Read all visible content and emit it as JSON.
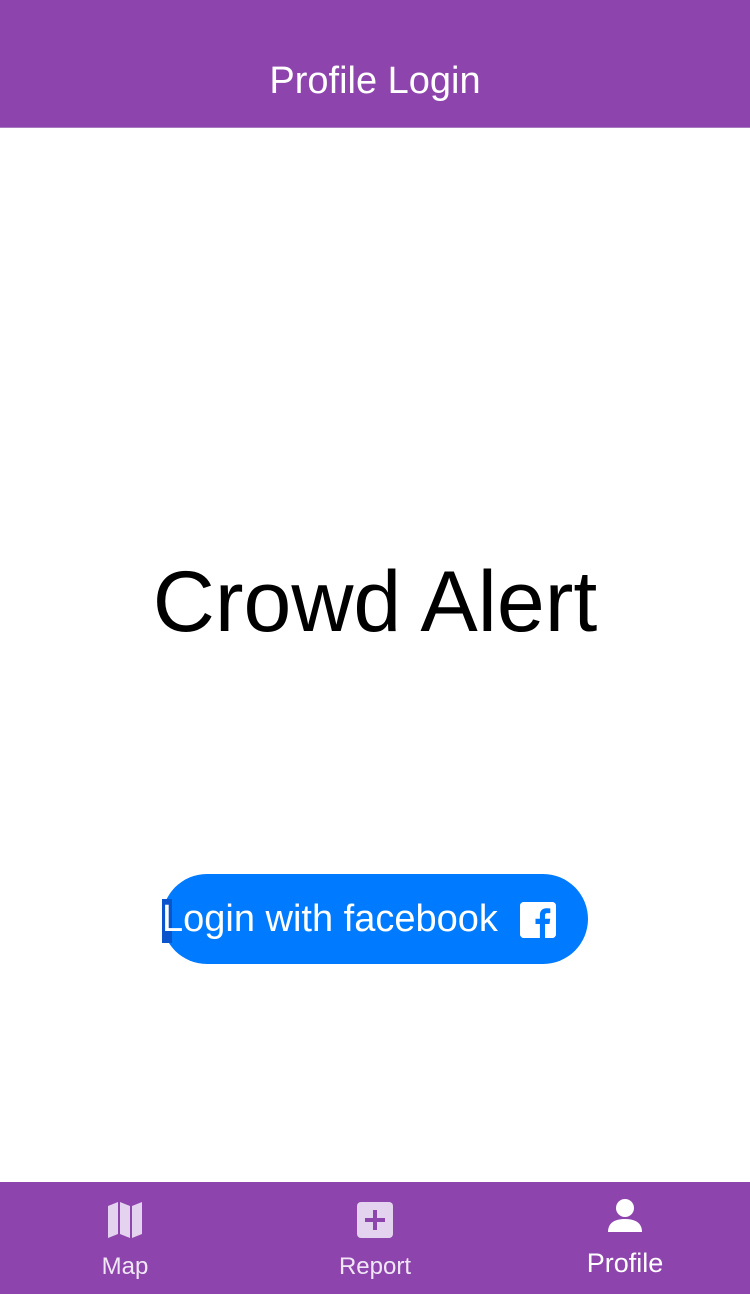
{
  "header": {
    "title": "Profile Login"
  },
  "main": {
    "app_name": "Crowd Alert",
    "login_button_label": "Login with facebook",
    "login_button_icon": "facebook-icon"
  },
  "tabs": [
    {
      "label": "Map",
      "icon": "map-icon",
      "active": false
    },
    {
      "label": "Report",
      "icon": "plus-square-icon",
      "active": false
    },
    {
      "label": "Profile",
      "icon": "person-icon",
      "active": true
    }
  ],
  "colors": {
    "bar": "#8e44ad",
    "button": "#007aff",
    "text_on_bar": "#ffffff",
    "title_text": "#000000"
  }
}
